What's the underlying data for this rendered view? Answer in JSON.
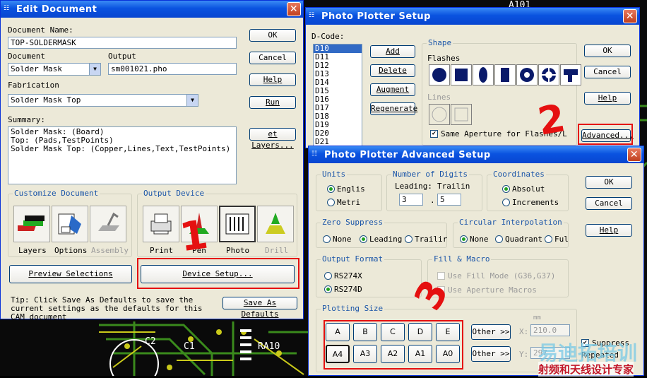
{
  "edit": {
    "title": "Edit Document",
    "doc_name_label": "Document Name:",
    "doc_name_value": "TOP-SOLDERMASK",
    "document_label": "Document",
    "document_value": "Solder Mask",
    "output_label": "Output",
    "output_value": "sm001021.pho",
    "fabrication_label": "Fabrication",
    "fabrication_value": "Solder Mask Top",
    "summary_label": "Summary:",
    "summary_lines": [
      "Solder Mask: (Board)",
      "Top: (Pads,TestPoints)",
      "Solder Mask Top: (Copper,Lines,Text,TestPoints)"
    ],
    "ok": "OK",
    "cancel": "Cancel",
    "help": "Help",
    "run": "Run",
    "set_layers": "et Layers...",
    "customize_label": "Customize Document",
    "output_device_label": "Output Device",
    "layers": "Layers",
    "options": "Options",
    "assembly": "Assembly",
    "print": "Print",
    "pen": "Pen",
    "photo": "Photo",
    "drill": "Drill",
    "preview": "Preview Selections",
    "device_setup": "Device Setup...",
    "tip": "Tip: Click Save As Defaults to save the current settings as the defaults for this CAM document",
    "save_defaults": "Save As Defaults"
  },
  "setup": {
    "title": "Photo Plotter Setup",
    "dcode_label": "D-Code:",
    "dcodes": [
      "D10",
      "D11",
      "D12",
      "D13",
      "D14",
      "D15",
      "D16",
      "D17",
      "D18",
      "D19",
      "D20",
      "D21"
    ],
    "add": "Add",
    "delete": "Delete",
    "augment": "Augment",
    "regenerate": "Regenerate",
    "shape_label": "Shape",
    "flashes_label": "Flashes",
    "lines_label": "Lines",
    "same_aperture": "Same Aperture for Flashes/L",
    "ok": "OK",
    "cancel": "Cancel",
    "help": "Help",
    "advanced": "Advanced..."
  },
  "adv": {
    "title": "Photo Plotter Advanced Setup",
    "units_label": "Units",
    "english": "Englis",
    "metric": "Metri",
    "digits_label": "Number of Digits",
    "leading_label": "Leading:",
    "trailing_label": "Trailin",
    "leading_value": "3",
    "trailing_value": "5",
    "coords_label": "Coordinates",
    "absolute": "Absolut",
    "incremental": "Increments",
    "zero_label": "Zero Suppress",
    "z_none": "None",
    "z_leading": "Leading",
    "z_trailing": "Trailir",
    "interp_label": "Circular Interpolation",
    "i_none": "None",
    "i_quadrant": "Quadrant",
    "i_full": "Ful",
    "format_label": "Output Format",
    "rs274x": "RS274X",
    "rs274d": "RS274D",
    "fill_label": "Fill & Macro",
    "fill_mode": "Use Fill Mode (G36,G37)",
    "aperture_macros": "Use Aperture Macros",
    "plot_label": "Plotting Size",
    "sizes_top": [
      "A",
      "B",
      "C",
      "D",
      "E"
    ],
    "sizes_bot": [
      "A4",
      "A3",
      "A2",
      "A1",
      "A0"
    ],
    "other": "Other >>",
    "mm": "mm",
    "x_label": "X:",
    "y_label": "Y:",
    "x_value": "210.0",
    "y_value": "297",
    "suppress": "Suppress",
    "repeated": "Repeated",
    "ok": "OK",
    "cancel": "Cancel",
    "help": "Help"
  },
  "annotations": {
    "one": "1",
    "two": "2",
    "three": "3"
  },
  "background": {
    "c2": "C2",
    "c1": "C1",
    "ra": "RA10",
    "a101": "A101"
  },
  "watermark": {
    "brand": "易迪拓培训",
    "slogan": "射频和天线设计专家"
  }
}
